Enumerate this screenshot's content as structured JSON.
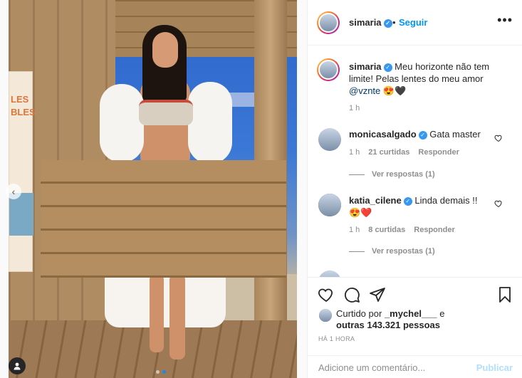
{
  "post": {
    "username": "simaria",
    "follow_label": "Seguir",
    "more_label": "•••",
    "carousel": {
      "current": 1,
      "total": 2
    }
  },
  "caption": {
    "username": "simaria",
    "text": "Meu horizonte não tem limite! Pelas lentes do meu amor",
    "mention": "@vznte",
    "emojis": "😍🖤",
    "time": "1 h"
  },
  "comments": [
    {
      "username": "monicasalgado",
      "text": "Gata master",
      "time": "1 h",
      "likes": "21 curtidas",
      "reply": "Responder",
      "view_replies": "Ver respostas (1)"
    },
    {
      "username": "katia_cilene",
      "text": "Linda demais !!",
      "emojis": "😍❤️",
      "time": "1 h",
      "likes": "8 curtidas",
      "reply": "Responder",
      "view_replies": "Ver respostas (1)"
    }
  ],
  "likes": {
    "prefix": "Curtido por",
    "user": "_mychel___",
    "connector": "e",
    "others": "outras 143.321 pessoas"
  },
  "timestamp": "HÁ 1 HORA",
  "add_comment": {
    "placeholder": "Adicione um comentário...",
    "publish_label": "Publicar"
  },
  "photo": {
    "poster_text": "LES\nBLES"
  }
}
